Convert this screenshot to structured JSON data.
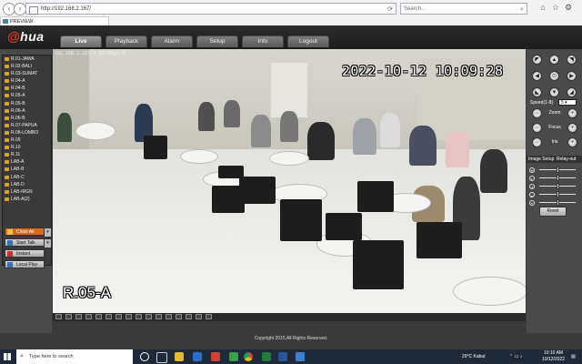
{
  "browser": {
    "url": "http://192.168.2.167/",
    "search_placeholder": "Search...",
    "tab_title": "PREVIEW"
  },
  "app": {
    "logo": "alhua",
    "menu": [
      {
        "label": "Live",
        "active": true
      },
      {
        "label": "Playback",
        "active": false
      },
      {
        "label": "Alarm",
        "active": false
      },
      {
        "label": "Setup",
        "active": false
      },
      {
        "label": "Info",
        "active": false
      },
      {
        "label": "Logout",
        "active": false
      }
    ]
  },
  "channels": [
    "R.01-JAWA",
    "R.02-BALI",
    "R.03-SUMAT",
    "R.04-A",
    "R.04-B",
    "R.05-A",
    "R.05-B",
    "R.06-A",
    "R.06-B",
    "R.07-PAPUA",
    "R.08-LOMBO",
    "R.09",
    "R.10",
    "R.11",
    "LAB-A",
    "LAB-B",
    "LAB-C",
    "LAB-D",
    "LAB-IRGN",
    "LAB-A(2)"
  ],
  "left_buttons": {
    "close_all": "Close All",
    "start_talk": "Start Talk",
    "instant_record": "Instant Record",
    "local_play": "Local Play"
  },
  "video": {
    "stream_info": "192.168.2.167:4 1012Kbps M",
    "timestamp": "2022-10-12 10:09:28",
    "camera_name": "R.05-A"
  },
  "ptz": {
    "speed_label": "Speed(1-8)",
    "speed_value": "5",
    "zoom_label": "Zoom",
    "focus_label": "Focus",
    "iris_label": "Iris"
  },
  "image_setup": {
    "title": "Image Setup",
    "relay": "Relay-out",
    "reset_label": "Reset",
    "levels": [
      0.5,
      0.5,
      0.5,
      0.5,
      0.5
    ]
  },
  "footer": {
    "copyright": "Copyright 2015,All Rights Reserved."
  },
  "taskbar": {
    "search_placeholder": "Type here to search",
    "weather": "29°C  Kabut",
    "time": "10:10 AM",
    "date": "10/12/2022"
  }
}
